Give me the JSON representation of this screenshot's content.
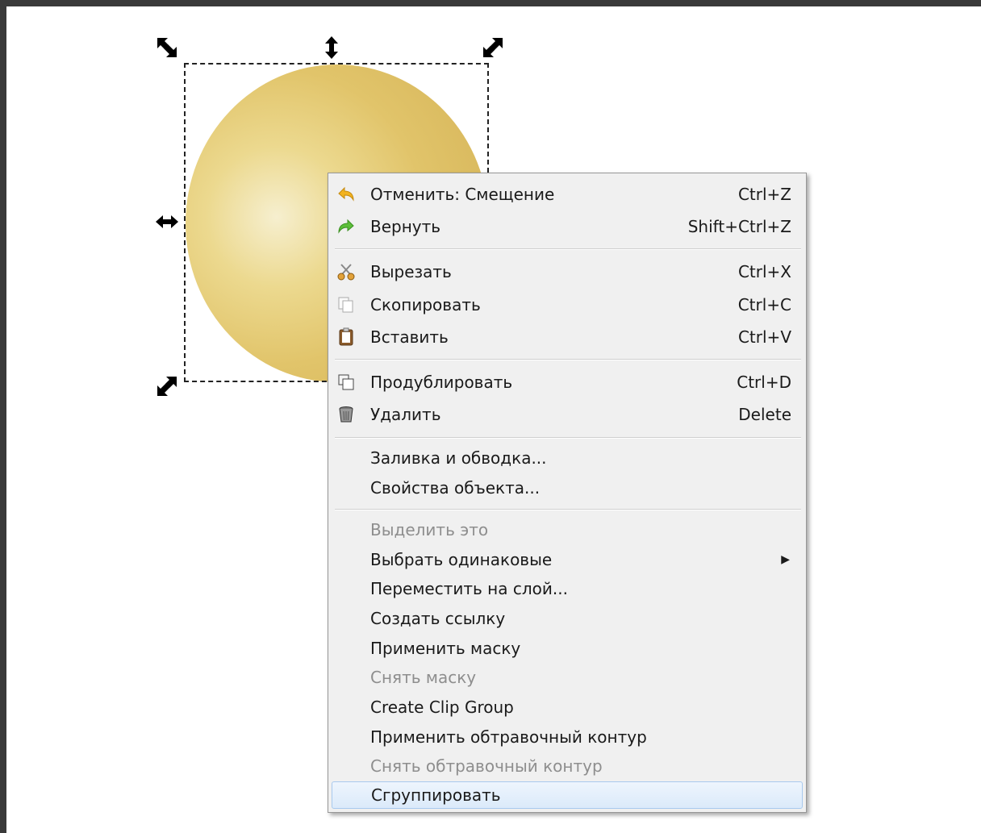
{
  "menu": {
    "groups": [
      [
        {
          "label": "Отменить: Смещение",
          "shortcut": "Ctrl+Z",
          "icon": "undo-icon",
          "enabled": true
        },
        {
          "label": "Вернуть",
          "shortcut": "Shift+Ctrl+Z",
          "icon": "redo-icon",
          "enabled": true
        }
      ],
      [
        {
          "label": "Вырезать",
          "shortcut": "Ctrl+X",
          "icon": "cut-icon",
          "enabled": true
        },
        {
          "label": "Скопировать",
          "shortcut": "Ctrl+C",
          "icon": "copy-icon",
          "enabled": true
        },
        {
          "label": "Вставить",
          "shortcut": "Ctrl+V",
          "icon": "paste-icon",
          "enabled": true
        }
      ],
      [
        {
          "label": "Продублировать",
          "shortcut": "Ctrl+D",
          "icon": "duplicate-icon",
          "enabled": true
        },
        {
          "label": "Удалить",
          "shortcut": "Delete",
          "icon": "delete-icon",
          "enabled": true
        }
      ],
      [
        {
          "label": "Заливка и обводка...",
          "enabled": true
        },
        {
          "label": "Свойства объекта...",
          "enabled": true
        }
      ],
      [
        {
          "label": "Выделить это",
          "enabled": false
        },
        {
          "label": "Выбрать одинаковые",
          "enabled": true,
          "submenu": true
        },
        {
          "label": "Переместить на слой...",
          "enabled": true
        },
        {
          "label": "Создать ссылку",
          "enabled": true
        },
        {
          "label": "Применить маску",
          "enabled": true
        },
        {
          "label": "Снять маску",
          "enabled": false
        },
        {
          "label": "Create Clip Group",
          "enabled": true
        },
        {
          "label": "Применить обтравочный контур",
          "enabled": true
        },
        {
          "label": "Снять обтравочный контур",
          "enabled": false
        },
        {
          "label": "Сгруппировать",
          "enabled": true,
          "highlighted": true
        }
      ]
    ]
  },
  "colors": {
    "sphere": "#e1c46a",
    "menu_bg": "#f0f0f0",
    "highlight": "#dbeafa",
    "disabled_text": "#8e8e8e"
  }
}
